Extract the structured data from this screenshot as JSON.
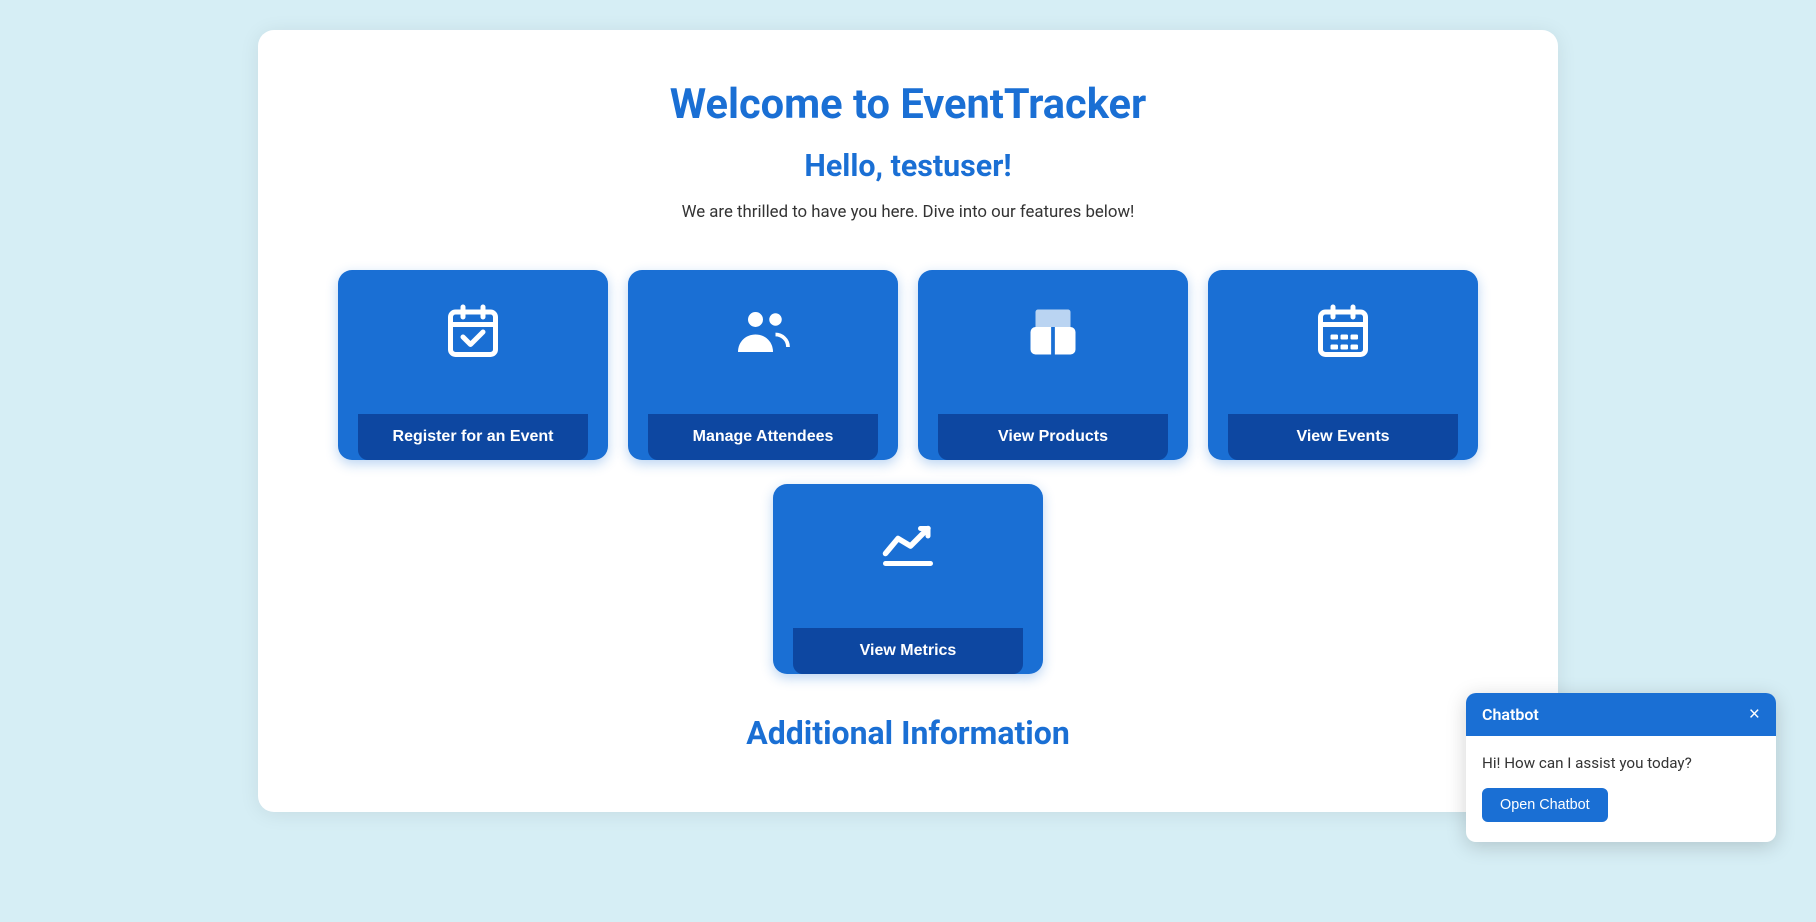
{
  "page": {
    "title": "Welcome to EventTracker",
    "greeting": "Hello, testuser!",
    "subtitle": "We are thrilled to have you here. Dive into our features below!",
    "additional_title": "Additional Information"
  },
  "cards": [
    {
      "id": "register-event",
      "label": "Register for an Event",
      "icon": "calendar-check"
    },
    {
      "id": "manage-attendees",
      "label": "Manage Attendees",
      "icon": "group"
    },
    {
      "id": "view-products",
      "label": "View Products",
      "icon": "box"
    },
    {
      "id": "view-events",
      "label": "View Events",
      "icon": "calendar-grid"
    }
  ],
  "center_card": {
    "id": "view-metrics",
    "label": "View Metrics",
    "icon": "metrics"
  },
  "chatbot": {
    "title": "Chatbot",
    "message": "Hi! How can I assist you today?",
    "open_button_label": "Open Chatbot",
    "close_label": "×"
  },
  "colors": {
    "primary": "#1a6fd4",
    "dark_btn": "#0d47a1",
    "background": "#d6eef5",
    "white": "#ffffff"
  }
}
